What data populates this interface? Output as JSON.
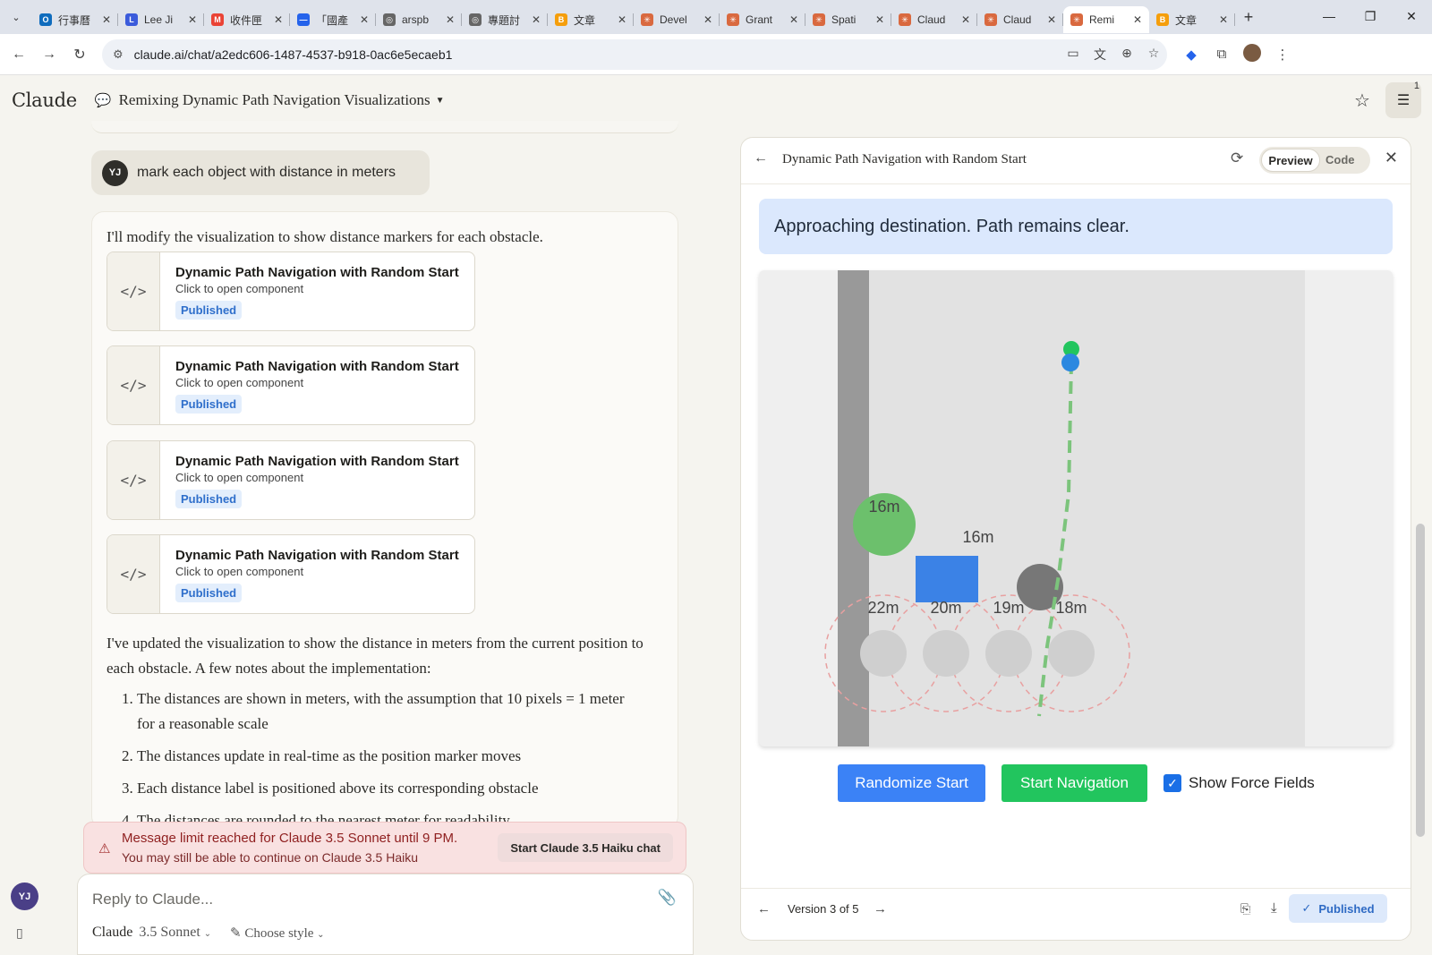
{
  "browser": {
    "tabs": [
      {
        "label": "行事曆",
        "icon": "outlook-icon",
        "color": "#0f6cbd",
        "glyph": "O"
      },
      {
        "label": "Lee Ji",
        "icon": "teams-icon",
        "color": "#3b5bdb",
        "glyph": "L"
      },
      {
        "label": "收件匣",
        "icon": "gmail-icon",
        "color": "#ea4335",
        "glyph": "M"
      },
      {
        "label": "「國產",
        "icon": "site-icon",
        "color": "#2563eb",
        "glyph": "—"
      },
      {
        "label": "arspb",
        "icon": "globe-icon",
        "color": "#666666",
        "glyph": "◎"
      },
      {
        "label": "專題討",
        "icon": "globe-icon",
        "color": "#666666",
        "glyph": "◎"
      },
      {
        "label": "文章",
        "icon": "blogger-icon",
        "color": "#f59e0b",
        "glyph": "B"
      },
      {
        "label": "Devel",
        "icon": "claude-icon",
        "color": "#d9693f",
        "glyph": "✳"
      },
      {
        "label": "Grant",
        "icon": "claude-icon",
        "color": "#d9693f",
        "glyph": "✳"
      },
      {
        "label": "Spati",
        "icon": "claude-icon",
        "color": "#d9693f",
        "glyph": "✳"
      },
      {
        "label": "Claud",
        "icon": "claude-icon",
        "color": "#d9693f",
        "glyph": "✳"
      },
      {
        "label": "Claud",
        "icon": "claude-icon",
        "color": "#d9693f",
        "glyph": "✳"
      },
      {
        "label": "Remi",
        "icon": "claude-icon",
        "color": "#d9693f",
        "glyph": "✳",
        "active": true
      },
      {
        "label": "文章",
        "icon": "blogger-icon",
        "color": "#f59e0b",
        "glyph": "B"
      }
    ],
    "url": "claude.ai/chat/a2edc606-1487-4537-b918-0ac6e5ecaeb1"
  },
  "header": {
    "logo": "Claude",
    "chat_title": "Remixing Dynamic Path Navigation Visualizations",
    "notification_count": "1"
  },
  "chat": {
    "user_initials": "YJ",
    "user_message": "mark each object with distance in meters",
    "assistant_intro": "I'll modify the visualization to show distance markers for each obstacle.",
    "artifacts": [
      {
        "title": "Dynamic Path Navigation with Random Start",
        "subtitle": "Click to open component",
        "status": "Published"
      },
      {
        "title": "Dynamic Path Navigation with Random Start",
        "subtitle": "Click to open component",
        "status": "Published"
      },
      {
        "title": "Dynamic Path Navigation with Random Start",
        "subtitle": "Click to open component",
        "status": "Published"
      },
      {
        "title": "Dynamic Path Navigation with Random Start",
        "subtitle": "Click to open component",
        "status": "Published"
      }
    ],
    "summary": "I've updated the visualization to show the distance in meters from the current position to each obstacle. A few notes about the implementation:",
    "notes": [
      "The distances are shown in meters, with the assumption that 10 pixels = 1 meter for a reasonable scale",
      "The distances update in real-time as the position marker moves",
      "Each distance label is positioned above its corresponding obstacle",
      "The distances are rounded to the nearest meter for readability"
    ]
  },
  "limit_banner": {
    "line1": "Message limit reached for Claude 3.5 Sonnet until 9 PM.",
    "line2": "You may still be able to continue on Claude 3.5 Haiku",
    "button": "Start Claude 3.5 Haiku chat"
  },
  "composer": {
    "placeholder": "Reply to Claude...",
    "model_name": "Claude",
    "model_version": "3.5 Sonnet",
    "style_label": "Choose style"
  },
  "panel": {
    "title": "Dynamic Path Navigation with Random Start",
    "tab_preview": "Preview",
    "tab_code": "Code",
    "status_message": "Approaching destination. Path remains clear.",
    "randomize_label": "Randomize Start",
    "start_label": "Start Navigation",
    "force_fields_label": "Show Force Fields",
    "force_fields_checked": true,
    "version_label": "Version 3 of 5",
    "published_label": "Published"
  },
  "scene": {
    "labels": {
      "green_circle": "16m",
      "blue_square": "16m",
      "row": [
        "22m",
        "20m",
        "19m",
        "18m"
      ]
    },
    "colors": {
      "wall": "#999999",
      "green_obstacle": "#6cc06c",
      "blue_obstacle": "#3b82e6",
      "gray_obstacle": "#777777",
      "path": "#7cc47c",
      "goal": "#22c55e",
      "agent": "#2b88e0",
      "force_field": "#e8a0a0"
    }
  }
}
